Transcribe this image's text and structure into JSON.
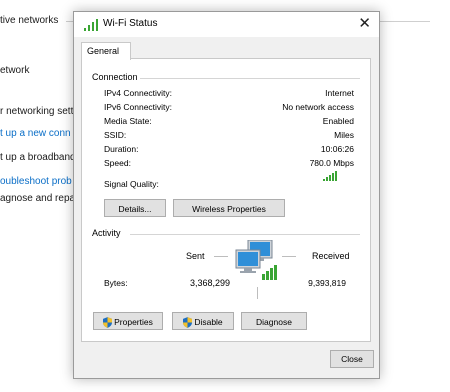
{
  "background": {
    "items": [
      "tive networks",
      "etwork",
      "r networking sett",
      "t up a new conn",
      "t up a broadband",
      "oubleshoot prob",
      "agnose and repa"
    ]
  },
  "window": {
    "title": "Wi-Fi Status",
    "close_glyph": "✕",
    "tab": "General"
  },
  "connection": {
    "heading": "Connection",
    "rows": [
      {
        "label": "IPv4 Connectivity:",
        "value": "Internet"
      },
      {
        "label": "IPv6 Connectivity:",
        "value": "No network access"
      },
      {
        "label": "Media State:",
        "value": "Enabled"
      },
      {
        "label": "SSID:",
        "value": "Miles"
      },
      {
        "label": "Duration:",
        "value": "10:06:26"
      },
      {
        "label": "Speed:",
        "value": "780.0 Mbps"
      }
    ],
    "signal_label": "Signal Quality:",
    "signal_bars": 5,
    "details_button": "Details...",
    "wireless_button": "Wireless Properties"
  },
  "activity": {
    "heading": "Activity",
    "sent_label": "Sent",
    "received_label": "Received",
    "bytes_label": "Bytes:",
    "sent_bytes": "3,368,299",
    "received_bytes": "9,393,819",
    "properties_button": "Properties",
    "disable_button": "Disable",
    "diagnose_button": "Diagnose"
  },
  "footer": {
    "close_button": "Close"
  },
  "colors": {
    "signal_green": "#3aa534",
    "link_blue": "#0a6ec7",
    "monitor_blue": "#2f8fd8"
  }
}
